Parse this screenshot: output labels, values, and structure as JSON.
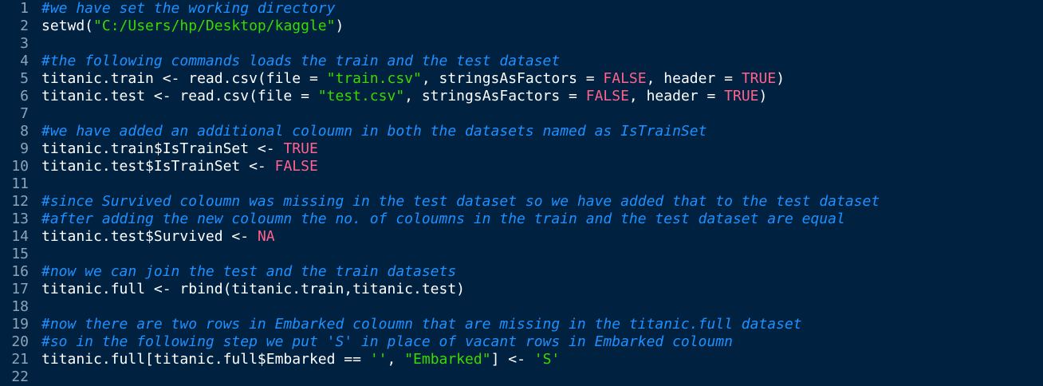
{
  "lines": [
    [
      {
        "t": "comment",
        "v": "#we have set the working directory"
      }
    ],
    [
      {
        "t": "plain",
        "v": "setwd("
      },
      {
        "t": "string",
        "v": "\"C:/Users/hp/Desktop/kaggle\""
      },
      {
        "t": "plain",
        "v": ")"
      }
    ],
    [],
    [
      {
        "t": "comment",
        "v": "#the following commands loads the train and the test dataset"
      }
    ],
    [
      {
        "t": "plain",
        "v": "titanic.train <- read.csv(file = "
      },
      {
        "t": "string",
        "v": "\"train.csv\""
      },
      {
        "t": "plain",
        "v": ", stringsAsFactors = "
      },
      {
        "t": "const",
        "v": "FALSE"
      },
      {
        "t": "plain",
        "v": ", header = "
      },
      {
        "t": "const",
        "v": "TRUE"
      },
      {
        "t": "plain",
        "v": ")"
      }
    ],
    [
      {
        "t": "plain",
        "v": "titanic.test <- read.csv(file = "
      },
      {
        "t": "string",
        "v": "\"test.csv\""
      },
      {
        "t": "plain",
        "v": ", stringsAsFactors = "
      },
      {
        "t": "const",
        "v": "FALSE"
      },
      {
        "t": "plain",
        "v": ", header = "
      },
      {
        "t": "const",
        "v": "TRUE"
      },
      {
        "t": "plain",
        "v": ")"
      }
    ],
    [],
    [
      {
        "t": "comment",
        "v": "#we have added an additional coloumn in both the datasets named as IsTrainSet"
      }
    ],
    [
      {
        "t": "plain",
        "v": "titanic.train$IsTrainSet <- "
      },
      {
        "t": "const",
        "v": "TRUE"
      }
    ],
    [
      {
        "t": "plain",
        "v": "titanic.test$IsTrainSet <- "
      },
      {
        "t": "const",
        "v": "FALSE"
      }
    ],
    [],
    [
      {
        "t": "comment",
        "v": "#since Survived coloumn was missing in the test dataset so we have added that to the test dataset"
      }
    ],
    [
      {
        "t": "comment",
        "v": "#after adding the new coloumn the no. of coloumns in the train and the test dataset are equal"
      }
    ],
    [
      {
        "t": "plain",
        "v": "titanic.test$Survived <- "
      },
      {
        "t": "const",
        "v": "NA"
      }
    ],
    [],
    [
      {
        "t": "comment",
        "v": "#now we can join the test and the train datasets"
      }
    ],
    [
      {
        "t": "plain",
        "v": "titanic.full <- rbind(titanic.train,titanic.test)"
      }
    ],
    [],
    [
      {
        "t": "comment",
        "v": "#now there are two rows in Embarked coloumn that are missing in the titanic.full dataset"
      }
    ],
    [
      {
        "t": "comment",
        "v": "#so in the following step we put 'S' in place of vacant rows in Embarked coloumn"
      }
    ],
    [
      {
        "t": "plain",
        "v": "titanic.full[titanic.full$Embarked == "
      },
      {
        "t": "string",
        "v": "''"
      },
      {
        "t": "plain",
        "v": ", "
      },
      {
        "t": "string",
        "v": "\"Embarked\""
      },
      {
        "t": "plain",
        "v": "] <- "
      },
      {
        "t": "string",
        "v": "'S'"
      }
    ],
    []
  ],
  "colors": {
    "background": "#002240",
    "line_number": "#8da3b8",
    "comment": "#1e90ff",
    "string": "#3ad900",
    "constant": "#ff628c",
    "plain": "#ffffff"
  }
}
